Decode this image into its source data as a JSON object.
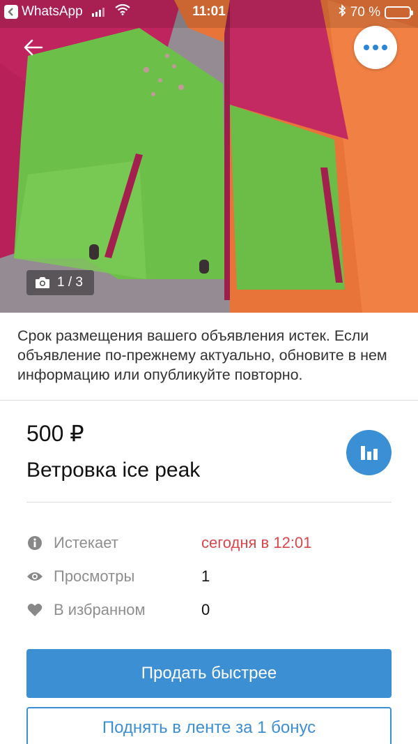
{
  "status_bar": {
    "back_app": "WhatsApp",
    "time": "11:01",
    "battery": "70 %",
    "battery_level": 0.7
  },
  "photo": {
    "counter": "1 / 3"
  },
  "notice": "Срок размещения вашего объявления истек. Если объявление по-прежнему актуально, обновите в нем информацию или опубликуйте повторно.",
  "listing": {
    "price": "500 ₽",
    "title": "Ветровка ice peak"
  },
  "meta": {
    "expires_label": "Истекает",
    "expires_value": "сегодня в 12:01",
    "views_label": "Просмотры",
    "views_value": "1",
    "favorites_label": "В избранном",
    "favorites_value": "0"
  },
  "actions": {
    "sell_faster": "Продать быстрее",
    "boost": "Поднять в ленте за 1 бонус"
  },
  "colors": {
    "accent_blue": "#3d8fd3",
    "alert_red": "#d9464b"
  },
  "icons": {
    "back": "arrow-left-icon",
    "more": "more-dots-icon",
    "camera": "camera-icon",
    "stats": "bar-chart-icon",
    "info": "info-icon",
    "views": "eye-icon",
    "favorites": "heart-icon"
  }
}
